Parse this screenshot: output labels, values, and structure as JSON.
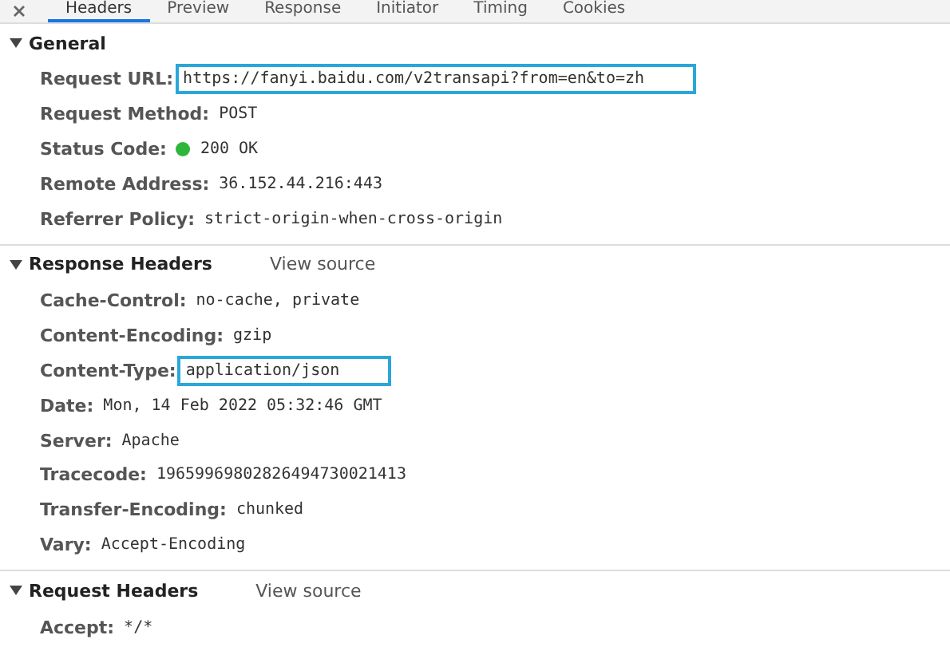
{
  "tabs": [
    {
      "label": "Headers",
      "selected": true
    },
    {
      "label": "Preview",
      "selected": false
    },
    {
      "label": "Response",
      "selected": false
    },
    {
      "label": "Initiator",
      "selected": false
    },
    {
      "label": "Timing",
      "selected": false
    },
    {
      "label": "Cookies",
      "selected": false
    }
  ],
  "sections": [
    {
      "title": "General",
      "expanded": true,
      "rows": [
        {
          "name": "Request URL:",
          "value": "https://fanyi.baidu.com/v2transapi?from=en&to=zh",
          "highlighted": true
        },
        {
          "name": "Request Method:",
          "value": "POST",
          "highlighted": false
        },
        {
          "name": "Status Code:",
          "value": "200 OK",
          "highlighted": false,
          "color": "#2fb53a"
        },
        {
          "name": "Remote Address:",
          "value": "36.152.44.216:443",
          "highlighted": false
        },
        {
          "name": "Referrer Policy:",
          "value": "strict-origin-when-cross-origin",
          "highlighted": false
        }
      ]
    },
    {
      "title": "Response Headers",
      "link": "View source",
      "expanded": true,
      "rows": [
        {
          "name": "Cache-Control:",
          "value": "no-cache, private",
          "highlighted": false
        },
        {
          "name": "Content-Encoding:",
          "value": "gzip",
          "highlighted": false
        },
        {
          "name": "Content-Type:",
          "value": "application/json",
          "highlighted": true
        },
        {
          "name": "Date:",
          "value": "Mon, 14 Feb 2022 05:32:46 GMT",
          "highlighted": false
        },
        {
          "name": "Server:",
          "value": "Apache",
          "highlighted": false
        },
        {
          "name": "Tracecode:",
          "value": "19659969802826494730021413",
          "highlighted": false
        },
        {
          "name": "Transfer-Encoding:",
          "value": "chunked",
          "highlighted": false
        },
        {
          "name": "Vary:",
          "value": "Accept-Encoding",
          "highlighted": false
        }
      ]
    },
    {
      "title": "Request Headers",
      "link": "View source",
      "expanded": true,
      "rows": [
        {
          "name": "Accept:",
          "value": "*/*",
          "highlighted": false
        }
      ]
    }
  ]
}
